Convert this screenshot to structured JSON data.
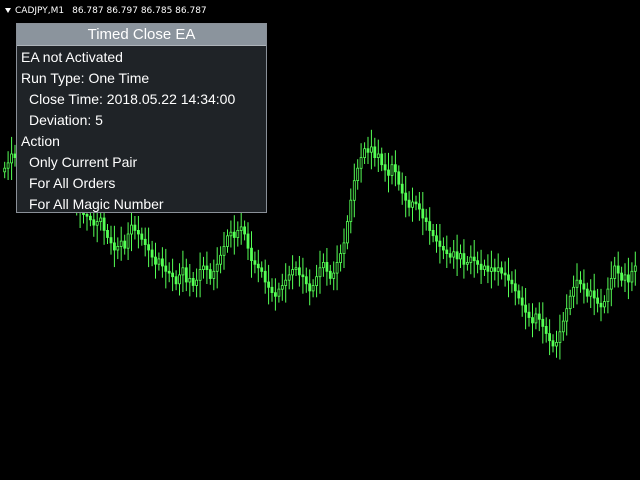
{
  "chart": {
    "symbol_timeframe": "CADJPY,M1",
    "ohlc_quotes": "86.787 86.797 86.785 86.787",
    "candle_color": "#55ff55",
    "background_color": "#000000",
    "closes": [
      101.6,
      101.9,
      102.4,
      102.2,
      102.6,
      103.1,
      103.4,
      102.8,
      102.9,
      102.5,
      102.1,
      101.9,
      102.3,
      102.4,
      102.0,
      101.6,
      101.2,
      101.0,
      100.6,
      100.2,
      100.0,
      99.6,
      99.2,
      99.0,
      98.9,
      98.7,
      98.4,
      98.6,
      98.8,
      98.1,
      97.7,
      97.4,
      97.0,
      97.2,
      97.5,
      97.1,
      97.9,
      98.4,
      98.1,
      97.9,
      97.6,
      97.3,
      97.0,
      96.6,
      96.2,
      96.5,
      96.1,
      95.8,
      95.7,
      95.5,
      95.1,
      95.6,
      96.0,
      95.2,
      95.4,
      95.0,
      95.3,
      95.9,
      96.1,
      95.9,
      95.4,
      95.8,
      96.2,
      96.7,
      97.2,
      97.8,
      98.0,
      97.7,
      98.1,
      98.3,
      97.9,
      97.1,
      96.4,
      96.2,
      96.0,
      95.8,
      95.2,
      94.9,
      94.6,
      94.4,
      94.8,
      95.0,
      95.3,
      95.6,
      95.9,
      96.0,
      95.6,
      95.5,
      95.1,
      94.7,
      95.0,
      95.5,
      96.0,
      96.3,
      95.8,
      95.4,
      95.7,
      96.3,
      96.8,
      97.4,
      98.6,
      99.8,
      100.9,
      101.6,
      102.2,
      102.7,
      102.5,
      102.8,
      102.2,
      102.4,
      101.8,
      101.5,
      101.2,
      101.8,
      101.4,
      100.7,
      100.2,
      99.8,
      99.4,
      99.7,
      99.6,
      99.3,
      98.8,
      98.6,
      98.1,
      97.8,
      97.5,
      97.2,
      97.0,
      96.8,
      96.6,
      96.9,
      96.5,
      96.8,
      96.2,
      96.3,
      96.6,
      96.4,
      96.2,
      95.9,
      96.1,
      95.8,
      96.0,
      95.8,
      96.0,
      95.7,
      95.6,
      95.3,
      95.1,
      94.7,
      94.3,
      93.9,
      93.5,
      93.2,
      92.9,
      93.4,
      93.1,
      92.7,
      92.3,
      91.9,
      91.6,
      91.8,
      92.4,
      93.0,
      93.7,
      94.4,
      94.9,
      95.3,
      95.1,
      94.8,
      94.4,
      94.7,
      94.3,
      94.0,
      93.8,
      94.1,
      94.8,
      95.4,
      96.1,
      95.7,
      95.3,
      95.6,
      95.2,
      95.8,
      96.1
    ]
  },
  "ea_panel": {
    "title": "Timed Close EA",
    "status": "EA not Activated",
    "run_type": "Run Type:  One Time",
    "close_time": "Close Time: 2018.05.22 14:34:00",
    "deviation": "Deviation: 5",
    "action_label": "Action",
    "actions": [
      "Only Current Pair",
      "For All Orders",
      "For All Magic Number"
    ]
  }
}
